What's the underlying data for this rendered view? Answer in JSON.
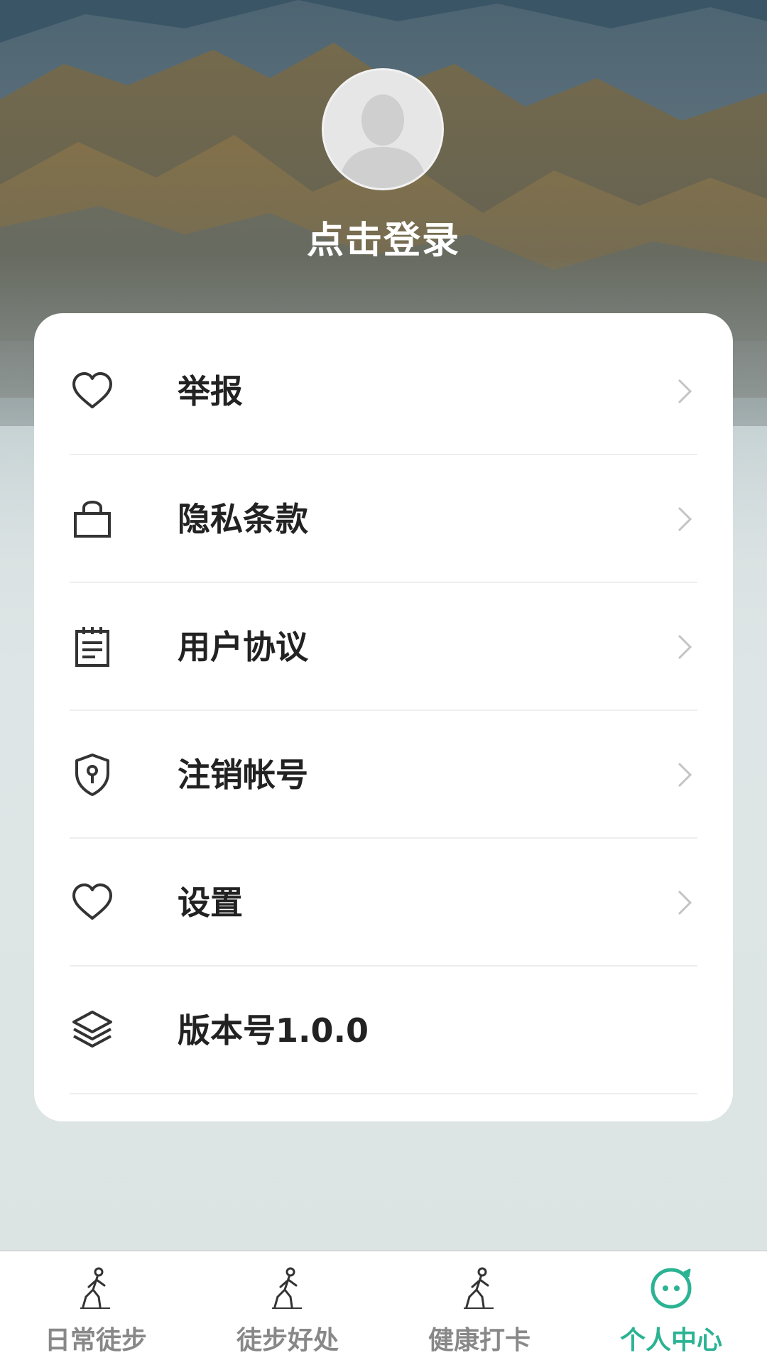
{
  "profile": {
    "login_label": "点击登录"
  },
  "menu": {
    "items": [
      {
        "label": "举报",
        "icon": "heart-icon",
        "has_chevron": true
      },
      {
        "label": "隐私条款",
        "icon": "bag-icon",
        "has_chevron": true
      },
      {
        "label": "用户协议",
        "icon": "notepad-icon",
        "has_chevron": true
      },
      {
        "label": "注销帐号",
        "icon": "shield-keyhole-icon",
        "has_chevron": true
      },
      {
        "label": "设置",
        "icon": "heart-icon",
        "has_chevron": true
      },
      {
        "label": "版本号1.0.0",
        "icon": "layers-icon",
        "has_chevron": false
      }
    ]
  },
  "tabbar": {
    "active_index": 3,
    "active_color": "#2bb393",
    "inactive_color": "#888888",
    "tabs": [
      {
        "label": "日常徒步",
        "icon": "walker-icon"
      },
      {
        "label": "徒步好处",
        "icon": "walker-icon"
      },
      {
        "label": "健康打卡",
        "icon": "walker-icon"
      },
      {
        "label": "个人中心",
        "icon": "smile-bubble-icon"
      }
    ]
  }
}
